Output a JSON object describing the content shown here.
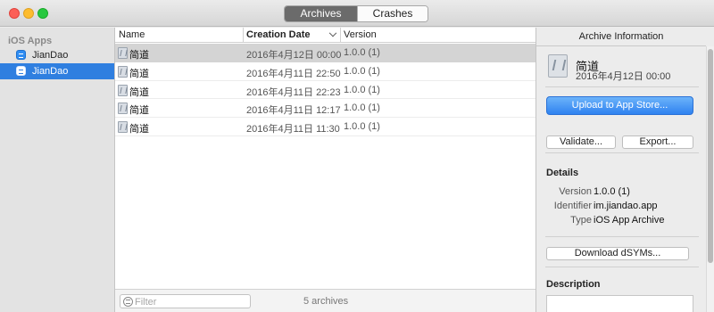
{
  "window": {
    "tabs": [
      {
        "label": "Archives",
        "selected": true
      },
      {
        "label": "Crashes",
        "selected": false
      }
    ]
  },
  "sidebar": {
    "heading": "iOS Apps",
    "items": [
      {
        "label": "JianDao",
        "icon": "app-icon",
        "selected": false
      },
      {
        "label": "JianDao",
        "icon": "app-icon",
        "selected": true
      }
    ]
  },
  "table": {
    "columns": {
      "name": "Name",
      "date": "Creation Date",
      "version": "Version"
    },
    "rows": [
      {
        "name": "简道",
        "date": "2016年4月12日 00:00",
        "version": "1.0.0 (1)",
        "selected": true
      },
      {
        "name": "简道",
        "date": "2016年4月11日 22:50",
        "version": "1.0.0 (1)",
        "selected": false
      },
      {
        "name": "简道",
        "date": "2016年4月11日 22:23",
        "version": "1.0.0 (1)",
        "selected": false
      },
      {
        "name": "简道",
        "date": "2016年4月11日 12:17",
        "version": "1.0.0 (1)",
        "selected": false
      },
      {
        "name": "简道",
        "date": "2016年4月11日 11:30",
        "version": "1.0.0 (1)",
        "selected": false
      }
    ],
    "filter_placeholder": "Filter",
    "count_text": "5 archives"
  },
  "inspector": {
    "header": "Archive Information",
    "name": "简道",
    "date": "2016年4月12日 00:00",
    "upload_label": "Upload to App Store...",
    "validate_label": "Validate...",
    "export_label": "Export...",
    "details_title": "Details",
    "details": {
      "version_label": "Version",
      "version_value": "1.0.0 (1)",
      "identifier_label": "Identifier",
      "identifier_value": "im.jiandao.app",
      "type_label": "Type",
      "type_value": "iOS App Archive"
    },
    "dsyms_label": "Download dSYMs...",
    "description_title": "Description"
  },
  "colors": {
    "accent": "#2f7fe0",
    "selected_segment": "#6b6b6b",
    "primary_button": "#3b8cf2"
  }
}
